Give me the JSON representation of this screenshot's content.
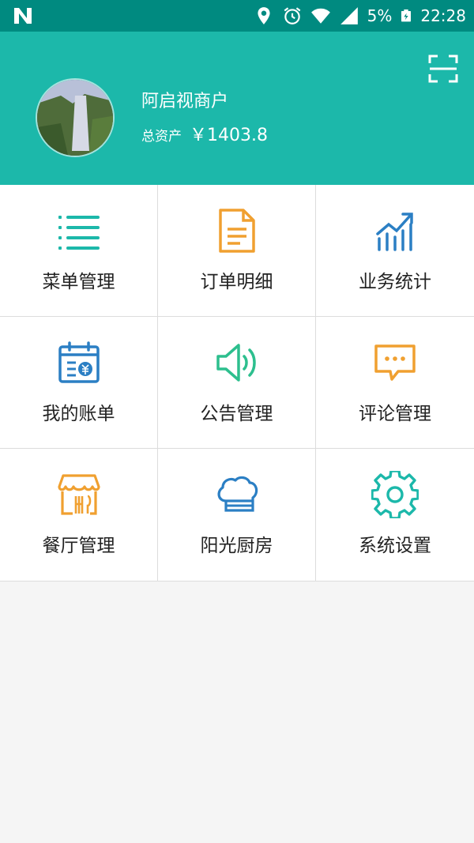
{
  "status_bar": {
    "battery": "5%",
    "time": "22:28"
  },
  "header": {
    "merchant_name": "阿启视商户",
    "assets_label": "总资产",
    "assets_amount": "￥1403.8"
  },
  "menu": [
    {
      "label": "菜单管理",
      "icon": "list-icon",
      "color": "#1cb8aa"
    },
    {
      "label": "订单明细",
      "icon": "document-icon",
      "color": "#f0a030"
    },
    {
      "label": "业务统计",
      "icon": "stats-icon",
      "color": "#2b7fc4"
    },
    {
      "label": "我的账单",
      "icon": "bill-icon",
      "color": "#2b7fc4"
    },
    {
      "label": "公告管理",
      "icon": "speaker-icon",
      "color": "#2dbf8e"
    },
    {
      "label": "评论管理",
      "icon": "comment-icon",
      "color": "#f0a030"
    },
    {
      "label": "餐厅管理",
      "icon": "restaurant-icon",
      "color": "#f0a030"
    },
    {
      "label": "阳光厨房",
      "icon": "chef-hat-icon",
      "color": "#2b7fc4"
    },
    {
      "label": "系统设置",
      "icon": "gear-icon",
      "color": "#1cb8aa"
    }
  ]
}
